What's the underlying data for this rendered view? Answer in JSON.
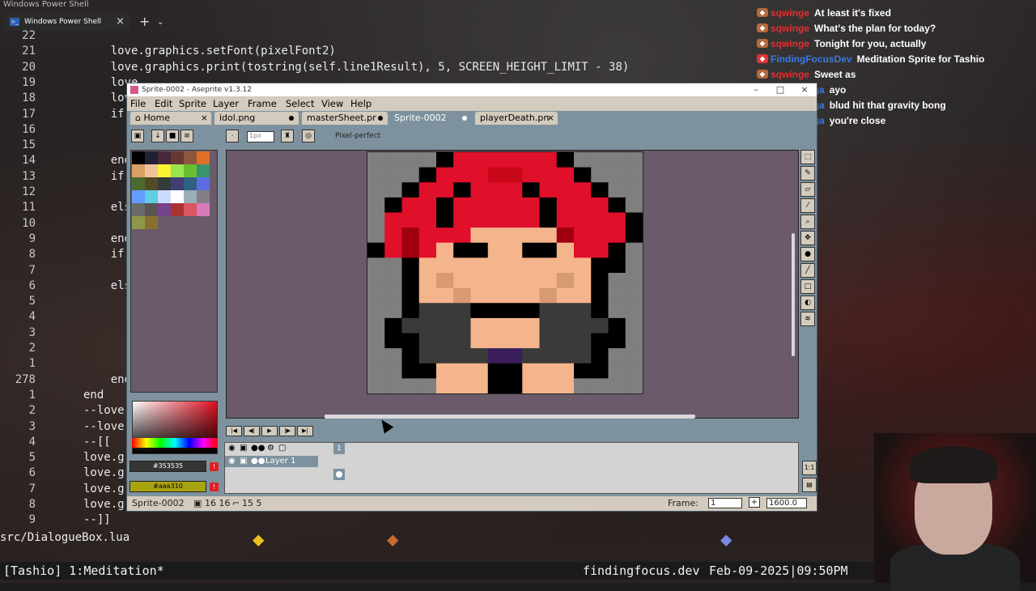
{
  "terminal": {
    "window_title": "Windows Power Shell",
    "tab_title": "Windows Power Shell",
    "file_path": "src/DialogueBox.lua",
    "lines": [
      {
        "n": "22",
        "code": ""
      },
      {
        "n": "21",
        "code": "        love.graphics.setFont(pixelFont2)"
      },
      {
        "n": "20",
        "code": "        love.graphics.print(tostring(self.line1Result), 5, SCREEN_HEIGHT_LIMIT - 38)"
      },
      {
        "n": "19",
        "code": "        love"
      },
      {
        "n": "18",
        "code": "        love"
      },
      {
        "n": "17",
        "code": "        if s"
      },
      {
        "n": "16",
        "code": ""
      },
      {
        "n": "15",
        "code": ""
      },
      {
        "n": "14",
        "code": "        end"
      },
      {
        "n": "13",
        "code": "        if b"
      },
      {
        "n": "12",
        "code": ""
      },
      {
        "n": "11",
        "code": "        else"
      },
      {
        "n": "10",
        "code": ""
      },
      {
        "n": "9",
        "code": "        end"
      },
      {
        "n": "8",
        "code": "        if n"
      },
      {
        "n": "7",
        "code": ""
      },
      {
        "n": "6",
        "code": "        else"
      },
      {
        "n": "5",
        "code": ""
      },
      {
        "n": "4",
        "code": ""
      },
      {
        "n": "3",
        "code": ""
      },
      {
        "n": "2",
        "code": ""
      },
      {
        "n": "1",
        "code": ""
      },
      {
        "n": "278",
        "code": "        end"
      },
      {
        "n": "1",
        "code": "    end"
      },
      {
        "n": "2",
        "code": "    --love.g"
      },
      {
        "n": "3",
        "code": "    --love.g"
      },
      {
        "n": "4",
        "code": "    --[["
      },
      {
        "n": "5",
        "code": "    love.gra"
      },
      {
        "n": "6",
        "code": "    love.gra"
      },
      {
        "n": "7",
        "code": "    love.gra"
      },
      {
        "n": "8",
        "code": "    love.gra"
      },
      {
        "n": "9",
        "code": "    --]]"
      }
    ],
    "status_left": "[Tashio] 1:Meditation*",
    "status_site": "findingfocus.dev",
    "status_time": "Feb-09-2025|09:50PM"
  },
  "chat": [
    {
      "user": "sqwinge",
      "msg": "At least it's fixed",
      "color": "#e03030",
      "badge": "mod"
    },
    {
      "user": "sqwinge",
      "msg": "What's the plan for today?",
      "color": "#e03030",
      "badge": "mod"
    },
    {
      "user": "sqwinge",
      "msg": "Tonight for you, actually",
      "color": "#e03030",
      "badge": "mod"
    },
    {
      "user": "FindingFocusDev",
      "msg": "Meditation Sprite for Tashio",
      "color": "#3a7ae0",
      "badge": "vip"
    },
    {
      "user": "sqwinge",
      "msg": "Sweet as",
      "color": "#e03030",
      "badge": "mod"
    },
    {
      "user": "saitomanga",
      "msg": "ayo",
      "color": "#3a7ae0",
      "badge": "sub"
    },
    {
      "user": "saitomanga",
      "msg": "blud hit that gravity bong",
      "color": "#3a7ae0",
      "badge": "sub"
    },
    {
      "user": "saitomanga",
      "msg": "you're close",
      "color": "#3a7ae0",
      "badge": "sub"
    }
  ],
  "aseprite": {
    "title": "Sprite-0002 - Aseprite v1.3.12",
    "menu": [
      "File",
      "Edit",
      "Sprite",
      "Layer",
      "Frame",
      "Select",
      "View",
      "Help"
    ],
    "tabs": [
      {
        "label": "Home"
      },
      {
        "label": "idol.png"
      },
      {
        "label": "masterSheet.pr"
      },
      {
        "label": "Sprite-0002"
      },
      {
        "label": "playerDeath.pn"
      }
    ],
    "toolbar": {
      "pixel_perfect": "Pixel-perfect",
      "brush_size": "1px"
    },
    "fg_color": "#353535",
    "bg_color": "#aaa310",
    "layer_name": "Layer 1",
    "frame_header": "1",
    "status": {
      "sprite": "Sprite-0002",
      "size": "16 16",
      "pos": "15 5",
      "frame_label": "Frame:",
      "frame_value": "1",
      "zoom": "1600.0"
    },
    "sprite_pixels": {
      "palette": {
        ".": "#7f7f7f",
        "K": "#000000",
        "R": "#e0102a",
        "r": "#c8081a",
        "D": "#a00010",
        "S": "#f4b48c",
        "s": "#d89a70",
        "G": "#3a3a3a",
        "g": "#2c2c2c",
        "P": "#3a1f5c"
      },
      "rows": [
        "....KRRRRRRK....",
        "...KRRRrrRRRK...",
        "..KRRKRRRKRRRK..",
        ".KRRKRRRRRKRRRK.",
        ".RRRKRRRRRKRRRRK",
        ".RDRRRSSSSSDRRRK",
        "KRDRSKKSSKKSRRK.",
        "..KSSSSSSSSSSKK.",
        "..KSsSSSSSSsSK..",
        "..KSSsSSSSsSSK..",
        "..KGGGKKKKGGGK..",
        ".KGGGGSSSSGGGGK.",
        ".KKGGGSSSSGGGKK.",
        "..KGGGGPPGGGGK..",
        "..KKSSSKKSSSKK..",
        "....SSSKKSSS...."
      ]
    },
    "palette_colors": [
      "#000000",
      "#222034",
      "#45283c",
      "#663931",
      "#8f563b",
      "#df7126",
      "#d9a066",
      "#eec39a",
      "#fbf236",
      "#99e550",
      "#6abe30",
      "#37946e",
      "#4b692f",
      "#524b24",
      "#323c39",
      "#3f3f74",
      "#306082",
      "#5b6ee1",
      "#639bff",
      "#5fcde4",
      "#cbdbfc",
      "#ffffff",
      "#9badb7",
      "#847e87",
      "#696a6a",
      "#595652",
      "#76428a",
      "#ac3232",
      "#d95763",
      "#d77bba",
      "#8f974a",
      "#8a6f30"
    ]
  }
}
